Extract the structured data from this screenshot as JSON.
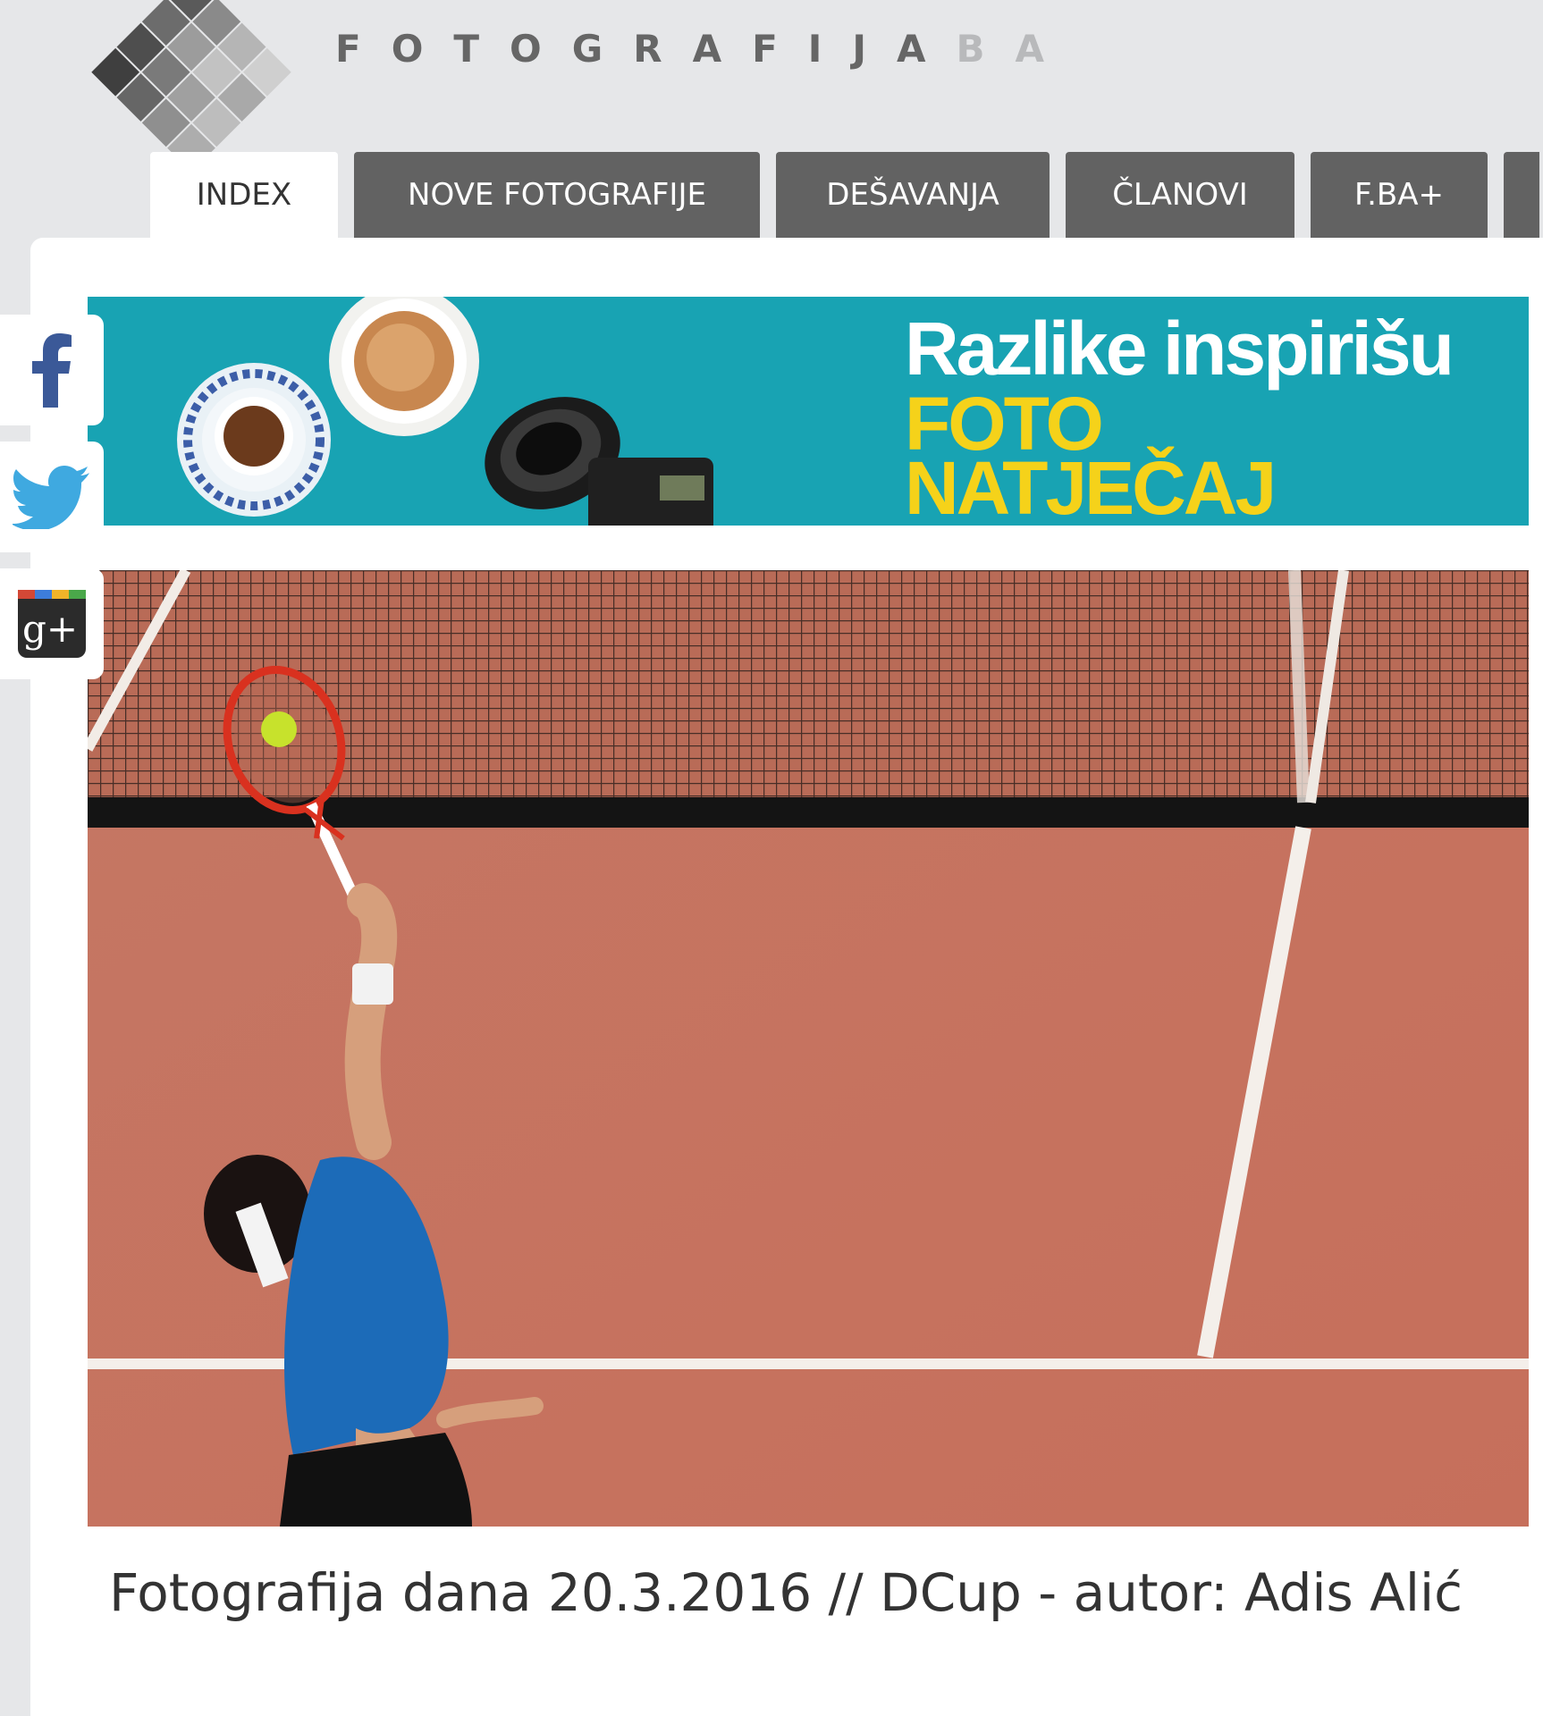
{
  "header": {
    "logo_letters": "FOTOGRAFIJA",
    "logo_suffix": "BA"
  },
  "nav": {
    "tabs": [
      {
        "label": "INDEX",
        "active": true
      },
      {
        "label": "NOVE FOTOGRAFIJE",
        "active": false
      },
      {
        "label": "DEŠAVANJA",
        "active": false
      },
      {
        "label": "ČLANOVI",
        "active": false
      },
      {
        "label": "F.BA+",
        "active": false
      }
    ]
  },
  "social": {
    "icons": [
      "facebook-icon",
      "twitter-icon",
      "google-plus-icon"
    ],
    "gplus_label": "g+"
  },
  "banner": {
    "line1": "Razlike inspirišu",
    "line2": "FOTO",
    "line3": "NATJEČAJ",
    "colors": {
      "background": "#18a3b3",
      "headline": "#ffffff",
      "accent": "#f5d21a"
    }
  },
  "photo_of_day": {
    "caption": "Fotografija dana 20.3.2016 // DCup - autor: Adis Alić"
  },
  "colors": {
    "page_bg": "#e6e7e9",
    "tab_bg": "#626262",
    "tab_active_bg": "#ffffff"
  }
}
